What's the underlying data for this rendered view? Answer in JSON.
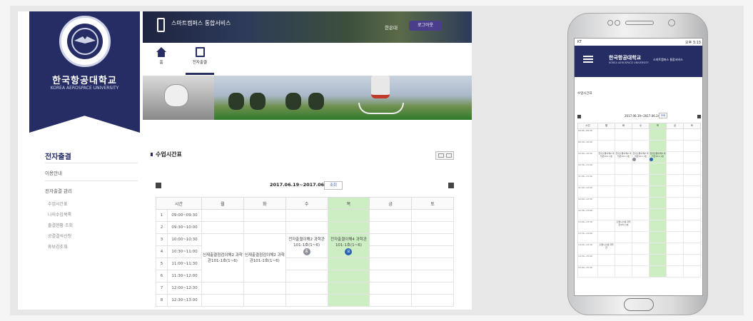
{
  "desktop": {
    "university": {
      "name_ko": "한국항공대학교",
      "name_en": "KOREA AEROSPACE UNIVERSITY"
    },
    "sidebar": {
      "title": "전자출결",
      "groups": [
        "이용안내",
        "전자출결 관리"
      ],
      "sub_items": [
        "수업시간표",
        "나의수강목록",
        "출결현황 조회",
        "공결결석신청",
        "휴보강조회"
      ]
    },
    "topbar": {
      "title": "스마트캠퍼스 통합서비스",
      "user": "한은대",
      "logout": "로그아웃"
    },
    "nav": {
      "home": "홈",
      "attendance": "전자출결"
    },
    "section_title": "수업시간표",
    "week": {
      "label": "2017.06.19~2017.06.24",
      "button": "조회"
    },
    "table": {
      "headers": [
        "시간",
        "월",
        "화",
        "수",
        "목",
        "금",
        "토"
      ],
      "rows": [
        {
          "no": "1",
          "time": "09:00~09:30"
        },
        {
          "no": "2",
          "time": "09:30~10:00"
        },
        {
          "no": "3",
          "time": "10:00~10:30"
        },
        {
          "no": "4",
          "time": "10:30~11:00"
        },
        {
          "no": "5",
          "time": "11:00~11:30"
        },
        {
          "no": "6",
          "time": "11:30~12:00"
        },
        {
          "no": "7",
          "time": "12:00~12:30"
        },
        {
          "no": "8",
          "time": "12:30~13:00"
        }
      ],
      "classes": {
        "mon": "신재출결점검이해2 과학관101-1호(1~6)",
        "tue": "신재출결점검이해2 과학관101-1호(1~6)",
        "wed": "전자출결이해2 과학관101-1호(1~6)",
        "thu": "전자출결이해4 과학관101-1호(1~6)"
      },
      "badges": {
        "wed": "종",
        "thu": "보"
      }
    },
    "colors": {
      "navy": "#262d64",
      "thursday": "#cdeec3"
    }
  },
  "phone": {
    "status_left": "KT",
    "status_right": "오후 3:13",
    "logo": "한국항공대학교",
    "logo_en": "KOREA AEROSPACE UNIVERSITY",
    "service": "스마트캠퍼스 통합서비스",
    "section_title": "수업시간표",
    "week": "2017.06.19~2017.06.24",
    "week_button": "조회",
    "headers": [
      "시간",
      "월",
      "화",
      "수",
      "목",
      "금",
      "토"
    ],
    "times": [
      "09:00~09:30",
      "09:30~10:00",
      "10:00~10:30",
      "10:30~11:00",
      "11:00~11:30",
      "11:30~12:00",
      "12:00~12:30",
      "12:30~13:00",
      "13:00~13:30",
      "13:30~14:00",
      "14:00~14:30",
      "14:30~15:00",
      "15:00~15:30"
    ],
    "classes": {
      "mon": "전자출결이해2 과학관101-1호",
      "tue": "전자출결이해2 과학관101-1호",
      "wed": "전자출결이해2 과학관101-1호",
      "thu": "전자출결이해4 과학관101-1호",
      "tue_pm": "출결시스템 과학관101-1호",
      "mon_pm": "출결시스템 과학관"
    }
  }
}
